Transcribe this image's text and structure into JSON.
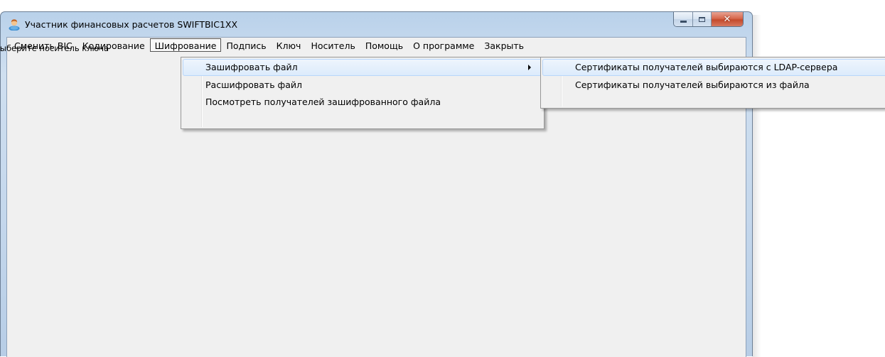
{
  "window": {
    "title": "Участник финансовых расчетов SWIFTBIC1XX",
    "icon": "user-icon",
    "caption": {
      "minimize": "minimize-icon",
      "maximize": "maximize-icon",
      "close_label": "✕"
    }
  },
  "menubar": {
    "items": [
      {
        "label": "Сменить BIC"
      },
      {
        "label": "Кодирование"
      },
      {
        "label": "Шифрование",
        "open": true
      },
      {
        "label": "Подпись"
      },
      {
        "label": "Ключ"
      },
      {
        "label": "Носитель"
      },
      {
        "label": "Помощь"
      },
      {
        "label": "О программе"
      },
      {
        "label": "Закрыть"
      }
    ]
  },
  "status_hint": "Выберите носитель ключа",
  "dropdown": {
    "items": [
      {
        "label": "Зашифровать файл",
        "has_submenu": true,
        "highlighted": true
      },
      {
        "label": "Расшифровать файл"
      },
      {
        "label": "Посмотреть получателей зашифрованного файла"
      }
    ]
  },
  "submenu": {
    "items": [
      {
        "label": "Сертификаты получателей выбираются с LDAP-сервера",
        "highlighted": true
      },
      {
        "label": "Сертификаты получателей выбираются из файла"
      }
    ]
  },
  "colors": {
    "frame": "#b9d1ea",
    "menu_bg": "#f0f0f0",
    "highlight": "#dcebfc",
    "close_button": "#c44a2c"
  }
}
